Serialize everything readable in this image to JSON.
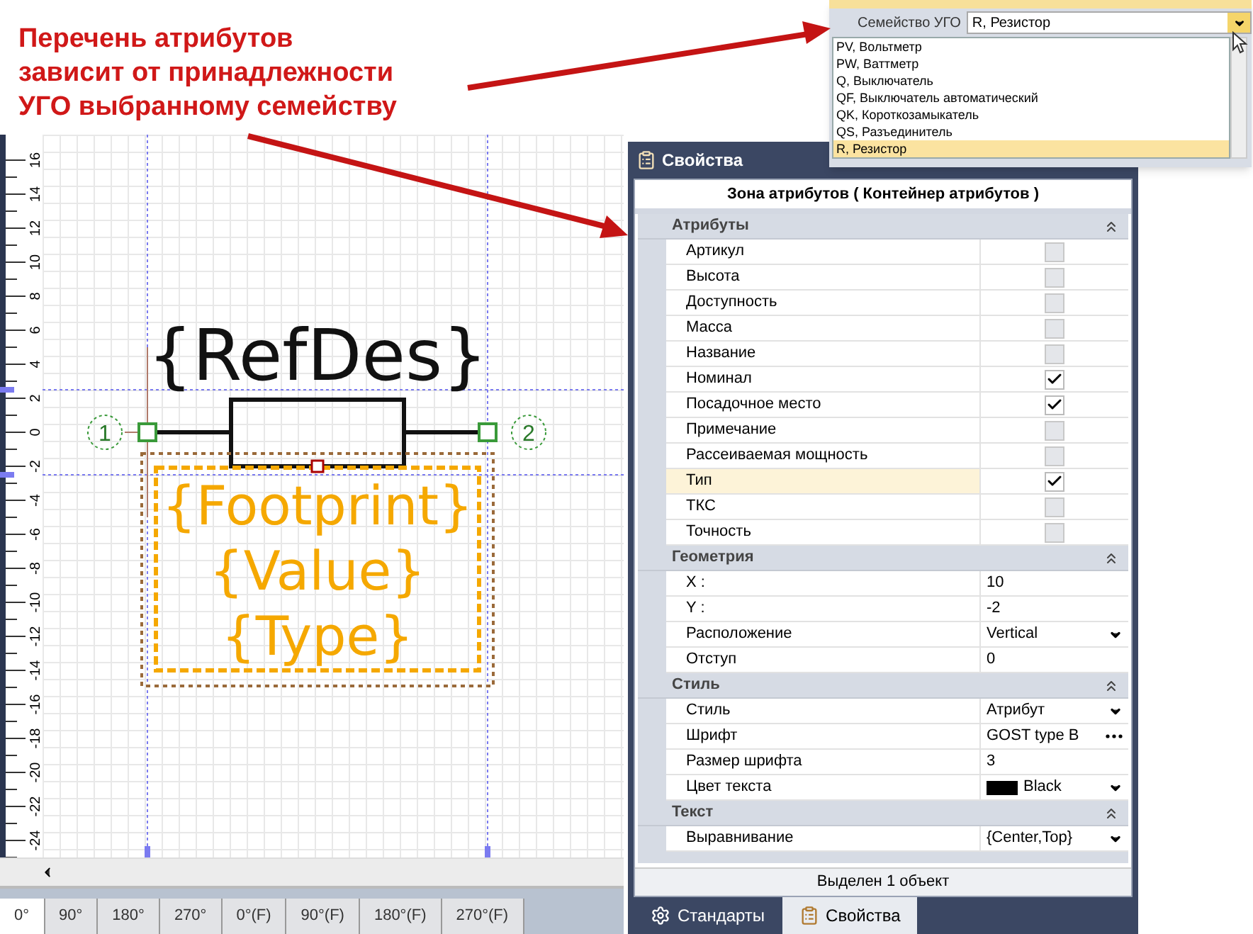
{
  "annotation": {
    "text": "Перечень атрибутов\nзависит от принадлежности\nУГО выбранному семейству"
  },
  "family_picker": {
    "label": "Семейство УГО",
    "value": "R, Резистор",
    "expanded": true,
    "options": [
      {
        "label": "PV, Вольтметр",
        "selected": false
      },
      {
        "label": "PW, Ваттметр",
        "selected": false
      },
      {
        "label": "Q, Выключатель",
        "selected": false
      },
      {
        "label": "QF, Выключатель автоматический",
        "selected": false
      },
      {
        "label": "QK, Короткозамыкатель",
        "selected": false
      },
      {
        "label": "QS, Разъединитель",
        "selected": false
      },
      {
        "label": "R, Резистор",
        "selected": true
      }
    ]
  },
  "canvas": {
    "ruler": [
      "16",
      "14",
      "12",
      "10",
      "8",
      "6",
      "4",
      "2",
      "0",
      "-2",
      "-4",
      "-6",
      "-8",
      "-10",
      "-12",
      "-14",
      "-16",
      "-18",
      "-20",
      "-22",
      "-24"
    ],
    "refdes": "{RefDes}",
    "pins": [
      "1",
      "2"
    ],
    "attribute_lines": [
      "{Footprint}",
      "{Value}",
      "{Type}"
    ]
  },
  "rotation_tabs": [
    {
      "label": "0°",
      "selected": true
    },
    {
      "label": "90°",
      "selected": false
    },
    {
      "label": "180°",
      "selected": false
    },
    {
      "label": "270°",
      "selected": false
    },
    {
      "label": "0°(F)",
      "selected": false
    },
    {
      "label": "90°(F)",
      "selected": false
    },
    {
      "label": "180°(F)",
      "selected": false
    },
    {
      "label": "270°(F)",
      "selected": false
    }
  ],
  "properties": {
    "title": "Свойства",
    "object": "Зона атрибутов ( Контейнер атрибутов )",
    "categories": [
      {
        "name": "Атрибуты",
        "expanded": true,
        "rows": [
          {
            "name": "Артикул",
            "kind": "checkbox",
            "checked": false,
            "selected": false
          },
          {
            "name": "Высота",
            "kind": "checkbox",
            "checked": false,
            "selected": false
          },
          {
            "name": "Доступность",
            "kind": "checkbox",
            "checked": false,
            "selected": false
          },
          {
            "name": "Масса",
            "kind": "checkbox",
            "checked": false,
            "selected": false
          },
          {
            "name": "Название",
            "kind": "checkbox",
            "checked": false,
            "selected": false
          },
          {
            "name": "Номинал",
            "kind": "checkbox",
            "checked": true,
            "selected": false
          },
          {
            "name": "Посадочное место",
            "kind": "checkbox",
            "checked": true,
            "selected": false
          },
          {
            "name": "Примечание",
            "kind": "checkbox",
            "checked": false,
            "selected": false
          },
          {
            "name": "Рассеиваемая мощность",
            "kind": "checkbox",
            "checked": false,
            "selected": false
          },
          {
            "name": "Тип",
            "kind": "checkbox",
            "checked": true,
            "selected": true
          },
          {
            "name": "ТКС",
            "kind": "checkbox",
            "checked": false,
            "selected": false
          },
          {
            "name": "Точность",
            "kind": "checkbox",
            "checked": false,
            "selected": false
          }
        ]
      },
      {
        "name": "Геометрия",
        "expanded": true,
        "rows": [
          {
            "name": "X :",
            "kind": "text",
            "value": "10",
            "selected": false
          },
          {
            "name": "Y :",
            "kind": "text",
            "value": "-2",
            "selected": false
          },
          {
            "name": "Расположение",
            "kind": "dropdown",
            "value": "Vertical",
            "selected": false
          },
          {
            "name": "Отступ",
            "kind": "text",
            "value": "0",
            "selected": false
          }
        ]
      },
      {
        "name": "Стиль",
        "expanded": true,
        "rows": [
          {
            "name": "Стиль",
            "kind": "dropdown",
            "value": "Атрибут",
            "selected": false
          },
          {
            "name": "Шрифт",
            "kind": "ellipsis",
            "value": "GOST type B",
            "selected": false
          },
          {
            "name": "Размер шрифта",
            "kind": "text",
            "value": "3",
            "selected": false
          },
          {
            "name": "Цвет текста",
            "kind": "color",
            "value": "Black",
            "color": "#000000",
            "selected": false
          }
        ]
      },
      {
        "name": "Текст",
        "expanded": true,
        "rows": [
          {
            "name": "Выравнивание",
            "kind": "dropdown",
            "value": "{Center,Top}",
            "selected": false
          }
        ]
      }
    ],
    "status": "Выделен 1 объект",
    "tabs": [
      {
        "label": "Стандарты",
        "selected": false
      },
      {
        "label": "Свойства",
        "selected": true
      }
    ]
  }
}
